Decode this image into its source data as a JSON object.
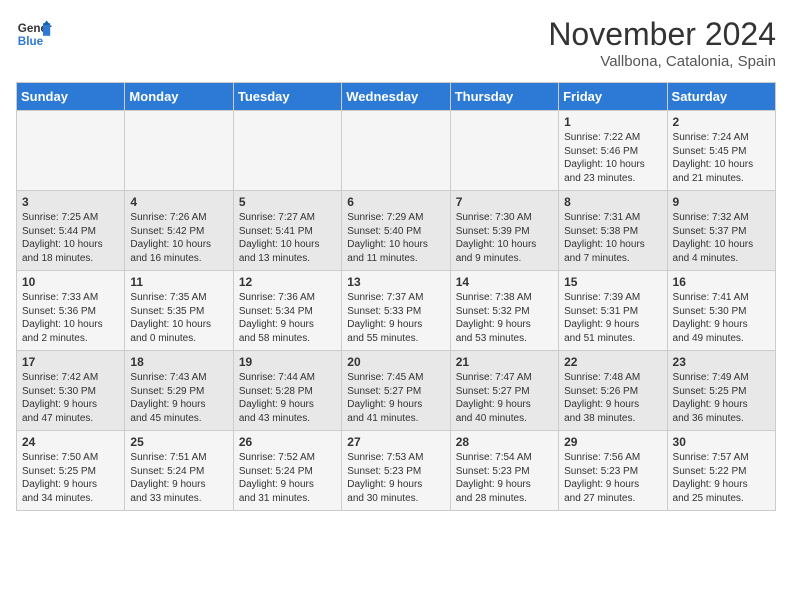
{
  "header": {
    "logo_line1": "General",
    "logo_line2": "Blue",
    "month": "November 2024",
    "location": "Vallbona, Catalonia, Spain"
  },
  "days_of_week": [
    "Sunday",
    "Monday",
    "Tuesday",
    "Wednesday",
    "Thursday",
    "Friday",
    "Saturday"
  ],
  "weeks": [
    [
      {
        "day": "",
        "info": ""
      },
      {
        "day": "",
        "info": ""
      },
      {
        "day": "",
        "info": ""
      },
      {
        "day": "",
        "info": ""
      },
      {
        "day": "",
        "info": ""
      },
      {
        "day": "1",
        "info": "Sunrise: 7:22 AM\nSunset: 5:46 PM\nDaylight: 10 hours\nand 23 minutes."
      },
      {
        "day": "2",
        "info": "Sunrise: 7:24 AM\nSunset: 5:45 PM\nDaylight: 10 hours\nand 21 minutes."
      }
    ],
    [
      {
        "day": "3",
        "info": "Sunrise: 7:25 AM\nSunset: 5:44 PM\nDaylight: 10 hours\nand 18 minutes."
      },
      {
        "day": "4",
        "info": "Sunrise: 7:26 AM\nSunset: 5:42 PM\nDaylight: 10 hours\nand 16 minutes."
      },
      {
        "day": "5",
        "info": "Sunrise: 7:27 AM\nSunset: 5:41 PM\nDaylight: 10 hours\nand 13 minutes."
      },
      {
        "day": "6",
        "info": "Sunrise: 7:29 AM\nSunset: 5:40 PM\nDaylight: 10 hours\nand 11 minutes."
      },
      {
        "day": "7",
        "info": "Sunrise: 7:30 AM\nSunset: 5:39 PM\nDaylight: 10 hours\nand 9 minutes."
      },
      {
        "day": "8",
        "info": "Sunrise: 7:31 AM\nSunset: 5:38 PM\nDaylight: 10 hours\nand 7 minutes."
      },
      {
        "day": "9",
        "info": "Sunrise: 7:32 AM\nSunset: 5:37 PM\nDaylight: 10 hours\nand 4 minutes."
      }
    ],
    [
      {
        "day": "10",
        "info": "Sunrise: 7:33 AM\nSunset: 5:36 PM\nDaylight: 10 hours\nand 2 minutes."
      },
      {
        "day": "11",
        "info": "Sunrise: 7:35 AM\nSunset: 5:35 PM\nDaylight: 10 hours\nand 0 minutes."
      },
      {
        "day": "12",
        "info": "Sunrise: 7:36 AM\nSunset: 5:34 PM\nDaylight: 9 hours\nand 58 minutes."
      },
      {
        "day": "13",
        "info": "Sunrise: 7:37 AM\nSunset: 5:33 PM\nDaylight: 9 hours\nand 55 minutes."
      },
      {
        "day": "14",
        "info": "Sunrise: 7:38 AM\nSunset: 5:32 PM\nDaylight: 9 hours\nand 53 minutes."
      },
      {
        "day": "15",
        "info": "Sunrise: 7:39 AM\nSunset: 5:31 PM\nDaylight: 9 hours\nand 51 minutes."
      },
      {
        "day": "16",
        "info": "Sunrise: 7:41 AM\nSunset: 5:30 PM\nDaylight: 9 hours\nand 49 minutes."
      }
    ],
    [
      {
        "day": "17",
        "info": "Sunrise: 7:42 AM\nSunset: 5:30 PM\nDaylight: 9 hours\nand 47 minutes."
      },
      {
        "day": "18",
        "info": "Sunrise: 7:43 AM\nSunset: 5:29 PM\nDaylight: 9 hours\nand 45 minutes."
      },
      {
        "day": "19",
        "info": "Sunrise: 7:44 AM\nSunset: 5:28 PM\nDaylight: 9 hours\nand 43 minutes."
      },
      {
        "day": "20",
        "info": "Sunrise: 7:45 AM\nSunset: 5:27 PM\nDaylight: 9 hours\nand 41 minutes."
      },
      {
        "day": "21",
        "info": "Sunrise: 7:47 AM\nSunset: 5:27 PM\nDaylight: 9 hours\nand 40 minutes."
      },
      {
        "day": "22",
        "info": "Sunrise: 7:48 AM\nSunset: 5:26 PM\nDaylight: 9 hours\nand 38 minutes."
      },
      {
        "day": "23",
        "info": "Sunrise: 7:49 AM\nSunset: 5:25 PM\nDaylight: 9 hours\nand 36 minutes."
      }
    ],
    [
      {
        "day": "24",
        "info": "Sunrise: 7:50 AM\nSunset: 5:25 PM\nDaylight: 9 hours\nand 34 minutes."
      },
      {
        "day": "25",
        "info": "Sunrise: 7:51 AM\nSunset: 5:24 PM\nDaylight: 9 hours\nand 33 minutes."
      },
      {
        "day": "26",
        "info": "Sunrise: 7:52 AM\nSunset: 5:24 PM\nDaylight: 9 hours\nand 31 minutes."
      },
      {
        "day": "27",
        "info": "Sunrise: 7:53 AM\nSunset: 5:23 PM\nDaylight: 9 hours\nand 30 minutes."
      },
      {
        "day": "28",
        "info": "Sunrise: 7:54 AM\nSunset: 5:23 PM\nDaylight: 9 hours\nand 28 minutes."
      },
      {
        "day": "29",
        "info": "Sunrise: 7:56 AM\nSunset: 5:23 PM\nDaylight: 9 hours\nand 27 minutes."
      },
      {
        "day": "30",
        "info": "Sunrise: 7:57 AM\nSunset: 5:22 PM\nDaylight: 9 hours\nand 25 minutes."
      }
    ]
  ]
}
